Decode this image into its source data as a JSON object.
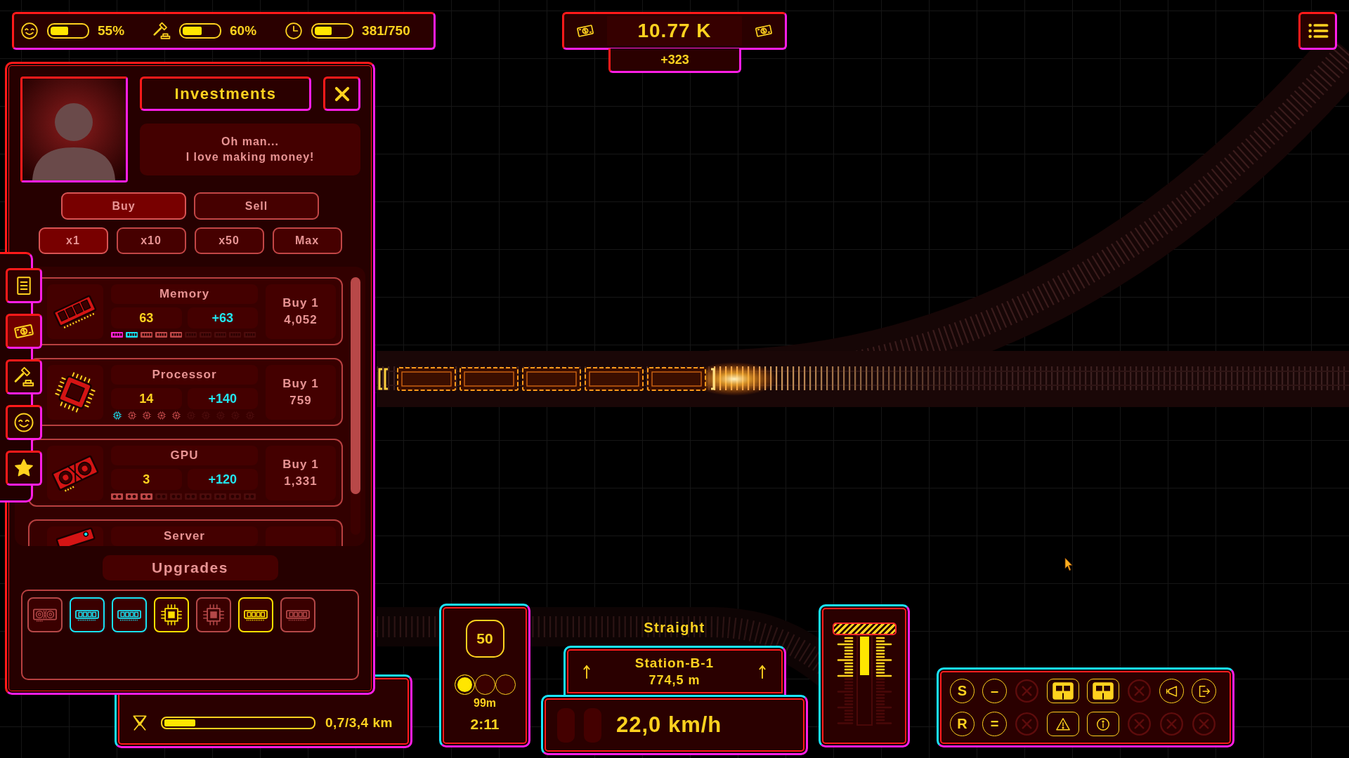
{
  "status_bar": {
    "stats": [
      {
        "kind": "mood",
        "level": 0.5,
        "reading": "55%"
      },
      {
        "kind": "gavel",
        "level": 0.54,
        "reading": "60%"
      },
      {
        "kind": "time",
        "level": 0.48,
        "reading": "381/750"
      }
    ]
  },
  "money": {
    "amount": "10.77 K",
    "income": "+323"
  },
  "side_tabs": [
    {
      "kind": "doc",
      "selected": false
    },
    {
      "kind": "money",
      "selected": true
    },
    {
      "kind": "gavel",
      "selected": false
    },
    {
      "kind": "mood",
      "selected": false
    },
    {
      "kind": "star",
      "selected": false
    }
  ],
  "investments": {
    "title": "Investments",
    "speech": [
      "Oh man...",
      "I love making money!"
    ],
    "modes": [
      {
        "label": "Buy",
        "selected": true
      },
      {
        "label": "Sell",
        "selected": false
      }
    ],
    "quantities": [
      {
        "label": "x1",
        "selected": true
      },
      {
        "label": "x10",
        "selected": false
      },
      {
        "label": "x50",
        "selected": false
      },
      {
        "label": "Max",
        "selected": false
      }
    ],
    "items": [
      {
        "kind": "memory",
        "name": "Memory",
        "owned": "63",
        "income": "+63",
        "price": [
          "Buy 1",
          "4,052"
        ],
        "tiers": [
          {
            "unlocked": true,
            "color": "#ff22d8"
          },
          {
            "unlocked": true,
            "color": "#19e3f5"
          },
          {
            "unlocked": true,
            "color": "#c04848"
          },
          {
            "unlocked": true,
            "color": "#c04848"
          },
          {
            "unlocked": true,
            "color": "#c04848"
          },
          {
            "unlocked": false
          },
          {
            "unlocked": false
          },
          {
            "unlocked": false
          },
          {
            "unlocked": false
          },
          {
            "unlocked": false
          }
        ]
      },
      {
        "kind": "processor",
        "name": "Processor",
        "owned": "14",
        "income": "+140",
        "price": [
          "Buy 1",
          "759"
        ],
        "tiers": [
          {
            "unlocked": true,
            "color": "#19e3f5"
          },
          {
            "unlocked": true,
            "color": "#c04848"
          },
          {
            "unlocked": true,
            "color": "#c04848"
          },
          {
            "unlocked": true,
            "color": "#c04848"
          },
          {
            "unlocked": true,
            "color": "#c04848"
          },
          {
            "unlocked": false
          },
          {
            "unlocked": false
          },
          {
            "unlocked": false
          },
          {
            "unlocked": false
          },
          {
            "unlocked": false
          }
        ]
      },
      {
        "kind": "gpu",
        "name": "GPU",
        "owned": "3",
        "income": "+120",
        "price": [
          "Buy 1",
          "1,331"
        ],
        "tiers": [
          {
            "unlocked": true,
            "color": "#c04848"
          },
          {
            "unlocked": true,
            "color": "#c04848"
          },
          {
            "unlocked": true,
            "color": "#c04848"
          },
          {
            "unlocked": false
          },
          {
            "unlocked": false
          },
          {
            "unlocked": false
          },
          {
            "unlocked": false
          },
          {
            "unlocked": false
          },
          {
            "unlocked": false
          },
          {
            "unlocked": false
          }
        ]
      },
      {
        "kind": "server",
        "name": "Server"
      }
    ],
    "upgrades_title": "Upgrades",
    "upgrades": [
      {
        "kind": "gpu",
        "color": "#b44848"
      },
      {
        "kind": "memory",
        "color": "#19e3f5"
      },
      {
        "kind": "memory",
        "color": "#19e3f5"
      },
      {
        "kind": "chip",
        "color": "#ffe000"
      },
      {
        "kind": "chip",
        "color": "#b44848"
      },
      {
        "kind": "memory",
        "color": "#ffe000"
      },
      {
        "kind": "memory",
        "color": "#b44848"
      }
    ]
  },
  "trip": {
    "level": 0.21,
    "reading": "0,7/3,4 km"
  },
  "signal": {
    "speed_limit": "50",
    "lights": [
      {
        "on": true
      },
      {
        "on": false
      },
      {
        "on": false
      }
    ],
    "distance": "99m",
    "time": "2:11"
  },
  "route": {
    "track": "Straight",
    "station": "Station-B-1",
    "distance": "774,5 m"
  },
  "speedometer": {
    "indicators": [
      {
        "on": false
      },
      {
        "on": false
      }
    ],
    "speed": "22,0 km/h"
  },
  "throttle": {
    "level": 0.45
  },
  "controls": [
    {
      "kind": "letter",
      "label": "S"
    },
    {
      "kind": "letter",
      "label": "–"
    },
    {
      "kind": "empty"
    },
    {
      "kind": "doors"
    },
    {
      "kind": "doors"
    },
    {
      "kind": "empty"
    },
    {
      "kind": "horn"
    },
    {
      "kind": "exit"
    },
    {
      "kind": "letter",
      "label": "R"
    },
    {
      "kind": "letter",
      "label": "="
    },
    {
      "kind": "empty"
    },
    {
      "kind": "warning"
    },
    {
      "kind": "info"
    },
    {
      "kind": "empty"
    },
    {
      "kind": "empty"
    },
    {
      "kind": "empty"
    }
  ]
}
